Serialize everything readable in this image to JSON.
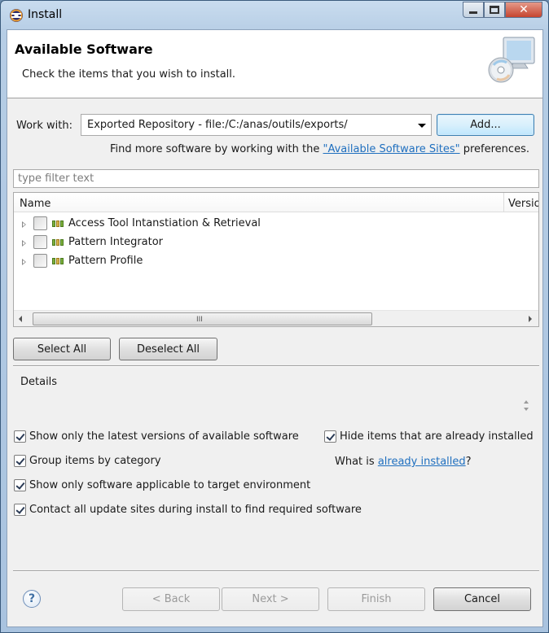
{
  "window": {
    "title": "Install"
  },
  "header": {
    "title": "Available Software",
    "description": "Check the items that you wish to install."
  },
  "work_with": {
    "label": "Work with:",
    "selected": "Exported Repository - file:/C:/anas/outils/exports/",
    "add_label": "Add..."
  },
  "find_more": {
    "prefix": "Find more software by working with the ",
    "link": "\"Available Software Sites\"",
    "suffix": " preferences."
  },
  "filter": {
    "placeholder": "type filter text",
    "value": ""
  },
  "tree": {
    "columns": {
      "name": "Name",
      "version": "Version"
    },
    "items": [
      {
        "label": "Access Tool Intanstiation & Retrieval",
        "checked": false
      },
      {
        "label": "Pattern Integrator",
        "checked": false
      },
      {
        "label": "Pattern Profile",
        "checked": false
      }
    ],
    "scroll_grip": "III"
  },
  "buttons": {
    "select_all": "Select All",
    "deselect_all": "Deselect All",
    "back": "< Back",
    "next": "Next >",
    "finish": "Finish",
    "cancel": "Cancel"
  },
  "details": {
    "label": "Details"
  },
  "options": {
    "latest_versions": {
      "label": "Show only the latest versions of available software",
      "checked": true
    },
    "hide_installed": {
      "label": "Hide items that are already installed",
      "checked": true
    },
    "group_by_category": {
      "label": "Group items by category",
      "checked": true
    },
    "target_env": {
      "label": "Show only software applicable to target environment",
      "checked": true
    },
    "contact_sites": {
      "label": "Contact all update sites during install to find required software",
      "checked": true
    }
  },
  "what_is": {
    "prefix": "What is ",
    "link": "already installed",
    "suffix": "?"
  },
  "help": {
    "glyph": "?"
  },
  "colors": {
    "link": "#1f6fbf",
    "focus_border": "#3c7fb1",
    "category_icon": "#7cae3b"
  }
}
